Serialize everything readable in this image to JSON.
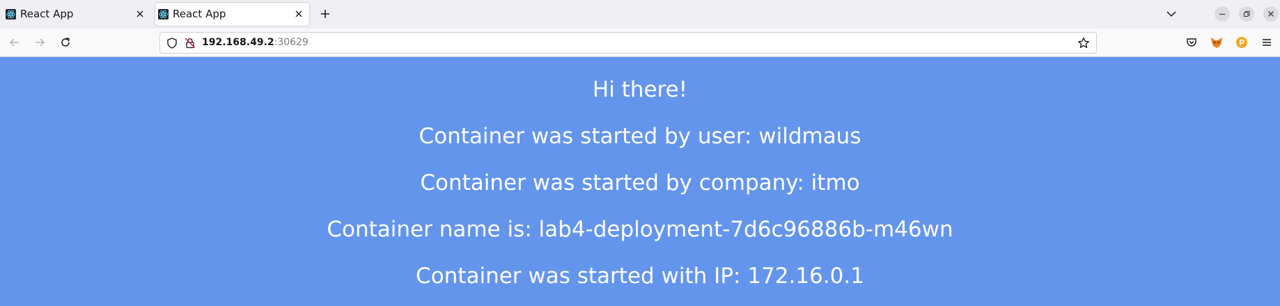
{
  "tabs": [
    {
      "title": "React App",
      "active": false
    },
    {
      "title": "React App",
      "active": true
    }
  ],
  "url": {
    "host": "192.168.49.2",
    "port": ":30629"
  },
  "icons": {
    "favicon": "react-logo-icon",
    "new_tab": "plus-icon",
    "list_tabs": "chevron-down-icon",
    "back": "arrow-left-icon",
    "forward": "arrow-right-icon",
    "reload": "reload-icon",
    "tracking": "shield-icon",
    "insecure": "lock-slash-icon",
    "bookmark": "star-icon",
    "pocket": "pocket-icon",
    "extension_1": "fox-icon",
    "extension_2": "coin-icon",
    "menu": "hamburger-menu-icon"
  },
  "colors": {
    "page_background": "#6495ed",
    "text": "#ffffff",
    "tab_strip": "#f0f0f4",
    "toolbar": "#f9f9fb"
  },
  "content": {
    "greeting": "Hi there!",
    "user_line": "Container was started by user: wildmaus",
    "company_line": "Container was started by company: itmo",
    "name_line": "Container name is: lab4-deployment-7d6c96886b-m46wn",
    "ip_line": "Container was started with IP: 172.16.0.1"
  }
}
